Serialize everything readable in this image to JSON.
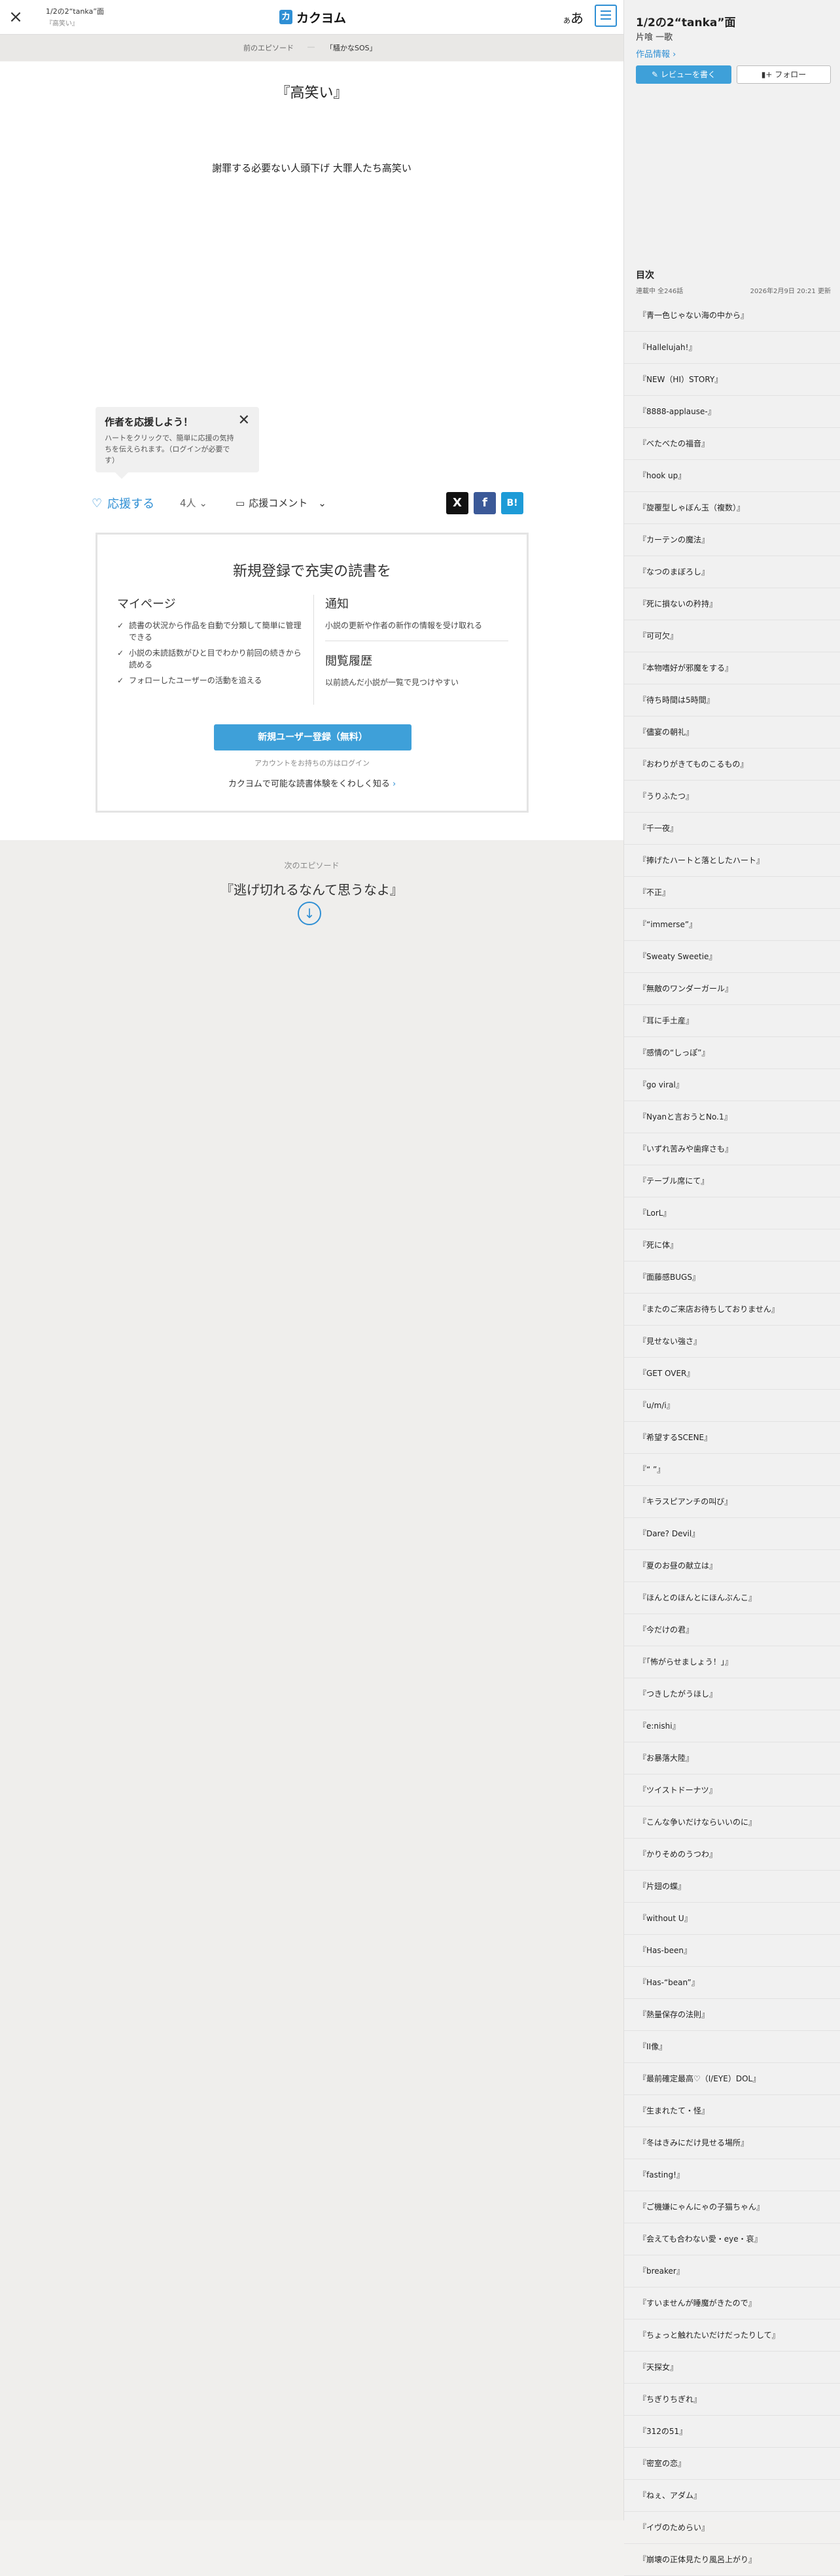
{
  "header": {
    "title": "1/2の2“tanka”面",
    "subtitle": "『高笑い』",
    "logo_text": "カクヨム",
    "logo_mark": "カ",
    "font_label_small": "あ",
    "font_label_large": "あ"
  },
  "episode_nav": {
    "prev": "前のエピソード",
    "separator": "―",
    "current": "「騒かなSOS」"
  },
  "episode": {
    "title": "『高笑い』",
    "body": "謝罪する必要ない人頭下げ 大罪人たち高笑い"
  },
  "tooltip": {
    "title": "作者を応援しよう！",
    "text": "ハートをクリックで、簡単に応援の気持ちを伝えられます。（ログインが必要です）"
  },
  "actions": {
    "support": "応援する",
    "support_count": "4人",
    "cheer_comment": "応援コメント",
    "sns": [
      "X",
      "f",
      "B!"
    ]
  },
  "signup": {
    "title": "新規登録で充実の読書を",
    "mypage_heading": "マイページ",
    "mypage_items": [
      "読書の状況から作品を自動で分類して簡単に管理できる",
      "小説の未読話数がひと目でわかり前回の続きから読める",
      "フォローしたユーザーの活動を追える"
    ],
    "notify_heading": "通知",
    "notify_text": "小説の更新や作者の新作の情報を受け取れる",
    "history_heading": "閲覧履歴",
    "history_text": "以前読んだ小説が一覧で見つけやすい",
    "button": "新規ユーザー登録（無料）",
    "login": "アカウントをお持ちの方はログイン",
    "more": "カクヨムで可能な読書体験をくわしく知る"
  },
  "next_episode": {
    "label": "次のエピソード",
    "title": "『逃げ切れるなんて思うなよ』"
  },
  "sidebar": {
    "title": "1/2の2“tanka”面",
    "author": "片喰 一歌",
    "info": "作品情報",
    "review_button": "レビューを書く",
    "follow_button": "フォロー",
    "toc_heading": "目次",
    "toc_count": "連載中 全246話",
    "toc_updated": "2026年2月9日 20:21 更新",
    "episodes": [
      "『青一色じゃない海の中から』",
      "『Hallelujah!』",
      "『NEW（HI）STORY』",
      "『8888-applause-』",
      "『べたべたの福音』",
      "『hook up』",
      "『旋覆型しゃぼん玉（複数）』",
      "『カーテンの魔法』",
      "『なつのまぼろし』",
      "『死に損ないの矜持』",
      "『可可欠』",
      "『本物嗜好が邪魔をする』",
      "『待ち時間は5時間』",
      "『儘宴の朝礼』",
      "『おわりがきてものこるもの』",
      "『うりふたつ』",
      "『千一夜』",
      "『捧げたハートと落としたハート』",
      "『不正』",
      "『“immerse”』",
      "『Sweaty Sweetie』",
      "『無敵のワンダーガール』",
      "『耳に手土産』",
      "『感情の“しっぽ”』",
      "『go viral』",
      "『Nyanと言おうとNo.1』",
      "『いずれ苦みや歯痒さも』",
      "『テーブル席にて』",
      "『LorL』",
      "『死に体』",
      "『面藤感BUGS』",
      "『またのご来店お待ちしておりません』",
      "『見せない強さ』",
      "『GET OVER』",
      "『u/m/i』",
      "『希望するSCENE』",
      "『“ ”』",
      "『キラスピアンチの叫び』",
      "『Dare? Devil』",
      "『夏のお昼の献立は』",
      "『ほんとのほんとにほんぶんこ』",
      "『今だけの君』",
      "『「怖がらせましょう！」』",
      "『つきしたがうほし』",
      "『e:nishi』",
      "『お暴落大陸』",
      "『ツイストドーナツ』",
      "『こんな争いだけならいいのに』",
      "『かりそめのうつわ』",
      "『片翅の蝶』",
      "『without U』",
      "『Has-been』",
      "『Has-“bean”』",
      "『熱量保存の法則』",
      "『II像』",
      "『最前確定最高♡（I/EYE）DOL』",
      "『生まれたて・怪』",
      "『冬はきみにだけ見せる場所』",
      "『fasting!』",
      "『ご機嫌にゃんにゃの子猫ちゃん』",
      "『会えても合わない愛・eye・哀』",
      "『breaker』",
      "『すいませんが睡魔がきたので』",
      "『ちょっと触れたいだけだったりして』",
      "『天探女』",
      "『ちぎりちぎれ』",
      "『312の51』",
      "『密室の恋』",
      "『ねぇ、アダム』",
      "『イヴのためらい』",
      "『崩壊の正体見たり風呂上がり』"
    ]
  }
}
